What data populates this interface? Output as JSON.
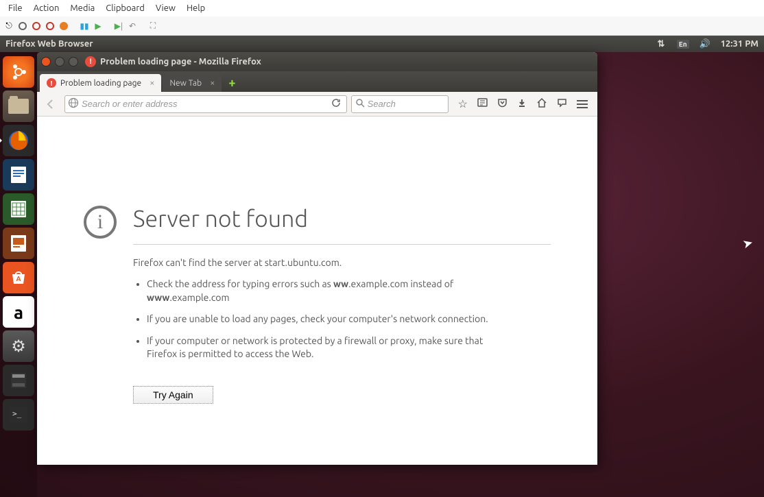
{
  "vm_menu": {
    "file": "File",
    "action": "Action",
    "media": "Media",
    "clipboard": "Clipboard",
    "view": "View",
    "help": "Help"
  },
  "panel": {
    "app_title": "Firefox Web Browser",
    "keyboard": "En",
    "time": "12:31 PM"
  },
  "launcher": {
    "amazon": "a"
  },
  "window": {
    "title": "Problem loading page - Mozilla Firefox"
  },
  "tabs": {
    "tab1": "Problem loading page",
    "tab2": "New Tab"
  },
  "urlbar": {
    "placeholder": "Search or enter address"
  },
  "searchbar": {
    "placeholder": "Search"
  },
  "error": {
    "title": "Server not found",
    "message": "Firefox can't find the server at start.ubuntu.com.",
    "li1a": "Check the address for typing errors such as ",
    "li1b": "ww",
    "li1c": ".example.com instead of ",
    "li1d": "www",
    "li1e": ".example.com",
    "li2": "If you are unable to load any pages, check your computer's network connection.",
    "li3": "If your computer or network is protected by a firewall or proxy, make sure that Firefox is permitted to access the Web.",
    "retry": "Try Again"
  },
  "info_icon_glyph": "i"
}
